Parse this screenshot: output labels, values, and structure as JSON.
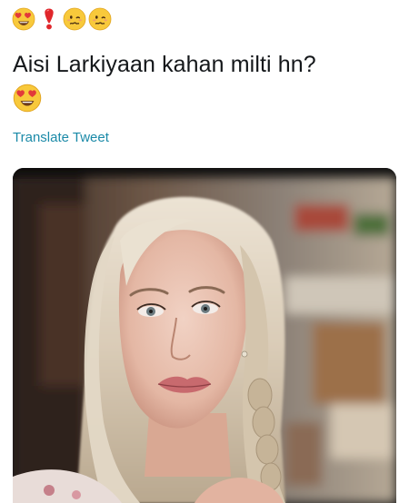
{
  "tweet": {
    "emoji_row": [
      "heart-eyes",
      "heavy-exclamation",
      "woozy-face",
      "woozy-face"
    ],
    "text": "Aisi Larkiyaan kahan milti hn?",
    "text_emoji": "heart-eyes",
    "translate_label": "Translate Tweet"
  },
  "media": {
    "alt": "",
    "icon": "photo"
  },
  "colors": {
    "text": "#14171a",
    "link": "#1b8aa8",
    "background": "#ffffff"
  }
}
